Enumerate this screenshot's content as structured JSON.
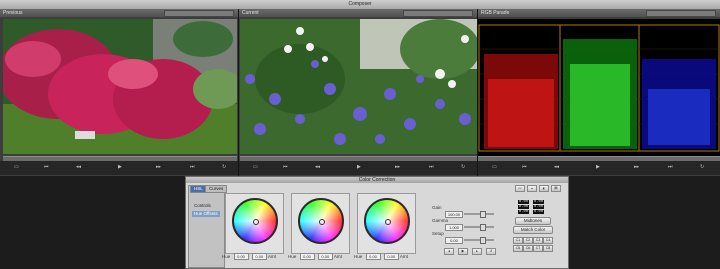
{
  "window": {
    "title": "Composer"
  },
  "viewers": {
    "left": {
      "label": "Previous"
    },
    "center": {
      "label": "Current"
    },
    "right": {
      "label": "RGB Parade"
    }
  },
  "transport_icons": [
    "monitor-icon",
    "prev-icon",
    "step-back-icon",
    "play-icon",
    "step-forward-icon",
    "next-icon",
    "loop-icon"
  ],
  "color_correction": {
    "title": "Color Correction",
    "tabs": [
      "HSL",
      "Curves"
    ],
    "list": [
      "Controls",
      "Hue Offsets"
    ],
    "wheels": [
      {
        "hue_label": "Hue",
        "hue_value": "0.00",
        "gain_value": "0.00",
        "gain_label": "Amt"
      },
      {
        "hue_label": "Hue",
        "hue_value": "0.00",
        "gain_value": "0.00",
        "gain_label": "Amt"
      },
      {
        "hue_label": "Hue",
        "hue_value": "0.00",
        "gain_value": "0.00",
        "gain_label": "Amt"
      }
    ],
    "sliders": [
      {
        "label": "Gain",
        "value": "100.00"
      },
      {
        "label": "Gamma",
        "value": "1.000"
      },
      {
        "label": "Setup",
        "value": "0.00"
      }
    ],
    "rgb_readout": [
      "0.00",
      "0.00",
      "0.00",
      "0.00",
      "0.00",
      "0.00"
    ],
    "mode_button": "Midtones",
    "match_button": "Match Color",
    "swatches": [
      "C1",
      "C2",
      "C3",
      "C4",
      "C5",
      "C6",
      "C7",
      "C8"
    ]
  }
}
